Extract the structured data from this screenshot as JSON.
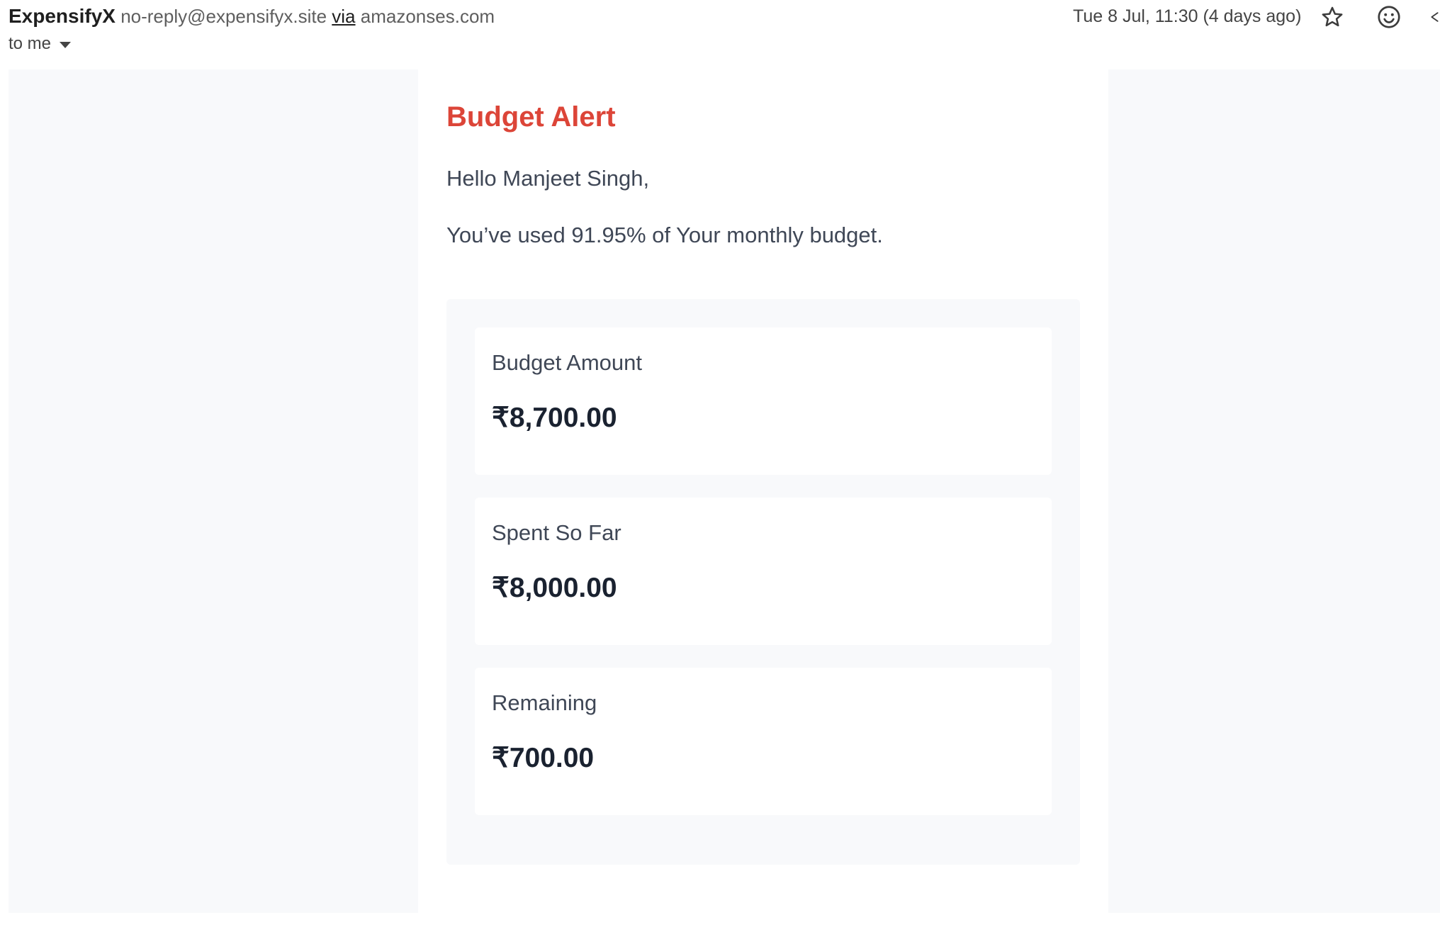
{
  "email": {
    "sender_name": "ExpensifyX",
    "sender_email": "no-reply@expensifyx.site",
    "via_label": "via",
    "via_domain": "amazonses.com",
    "recipient": "to me",
    "date": "Tue 8 Jul, 11:30 (4 days ago)",
    "icons": [
      "star-icon",
      "emoji-icon",
      "more-icon",
      "chevron-down-icon"
    ]
  },
  "alert": {
    "title": "Budget Alert",
    "greeting": "Hello Manjeet Singh,",
    "message": "You’ve used 91.95% of Your monthly budget.",
    "used_percent": 91.95,
    "title_color": "#dc4538",
    "items": [
      {
        "label": "Budget Amount",
        "value": "₹8,700.00"
      },
      {
        "label": "Spent So Far",
        "value": "₹8,000.00"
      },
      {
        "label": "Remaining",
        "value": "₹700.00"
      }
    ]
  }
}
